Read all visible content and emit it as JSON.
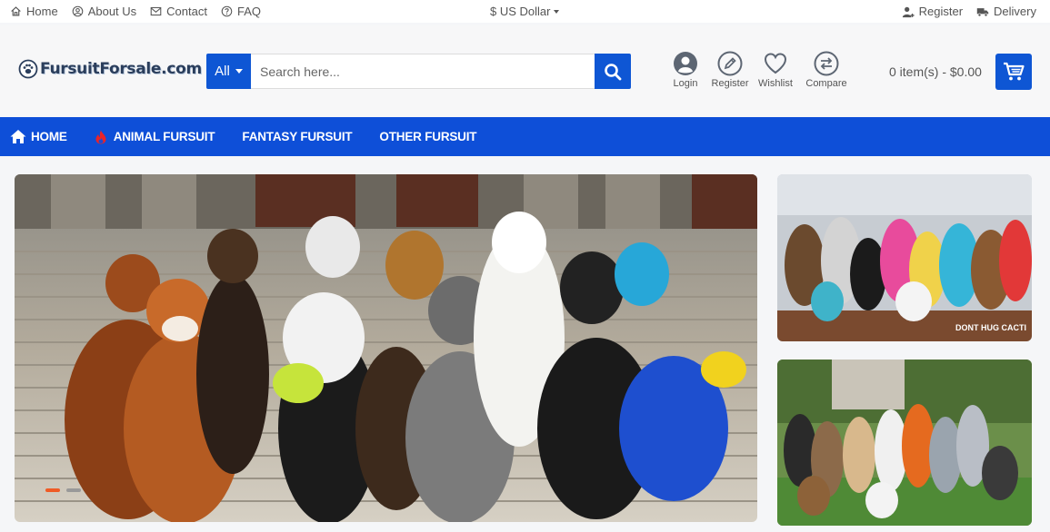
{
  "topbar": {
    "links": [
      {
        "label": "Home",
        "icon": "home-icon"
      },
      {
        "label": "About Us",
        "icon": "user-circle-icon"
      },
      {
        "label": "Contact",
        "icon": "envelope-icon"
      },
      {
        "label": "FAQ",
        "icon": "question-icon"
      }
    ],
    "currency": "$ US Dollar",
    "right": [
      {
        "label": "Register",
        "icon": "user-plus-icon"
      },
      {
        "label": "Delivery",
        "icon": "truck-icon"
      }
    ]
  },
  "header": {
    "logo_text": "FursuitForsale.com",
    "search": {
      "category": "All",
      "placeholder": "Search here..."
    },
    "actions": [
      {
        "label": "Login",
        "icon": "user-icon"
      },
      {
        "label": "Register",
        "icon": "pencil-icon"
      },
      {
        "label": "Wishlist",
        "icon": "heart-icon"
      },
      {
        "label": "Compare",
        "icon": "compare-icon"
      }
    ],
    "cart_total": "0 item(s) - $0.00"
  },
  "nav": {
    "items": [
      {
        "label": "HOME",
        "icon": "home-icon"
      },
      {
        "label": "ANIMAL FURSUIT",
        "icon": "flame-icon"
      },
      {
        "label": "FANTASY FURSUIT"
      },
      {
        "label": "OTHER FURSUIT"
      }
    ]
  },
  "slider": {
    "slide_count": 2,
    "active_slide": 1,
    "watermark_1": "DONT HUG CACTI"
  },
  "colors": {
    "primary": "#0e4fd8",
    "accent": "#ef5b26"
  }
}
